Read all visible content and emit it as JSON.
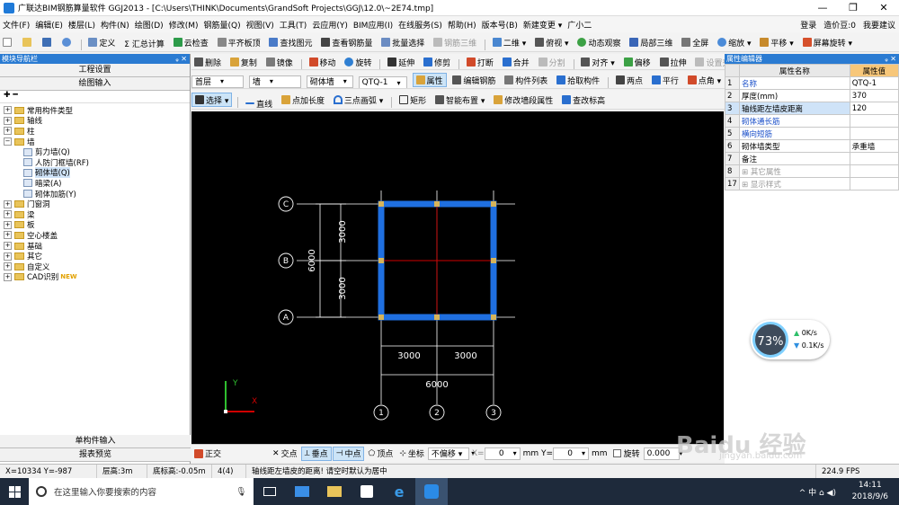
{
  "window": {
    "title": "广联达BIM钢筋算量软件 GGJ2013 - [C:\\Users\\THINK\\Documents\\GrandSoft Projects\\GGJ\\12.0\\~2E74.tmp]",
    "controls": [
      "—",
      "❐",
      "✕"
    ]
  },
  "menubar": {
    "items": [
      "文件(F)",
      "编辑(E)",
      "楼层(L)",
      "构件(N)",
      "绘图(D)",
      "修改(M)",
      "钢筋量(Q)",
      "视图(V)",
      "工具(T)",
      "云应用(Y)",
      "BIM应用(I)",
      "在线服务(S)",
      "帮助(H)",
      "版本号(B)",
      "新建变更 ▾",
      "广小二"
    ],
    "login": "登录",
    "coins": "造价豆:0",
    "suggest": "我要建议"
  },
  "toolbar1": {
    "items": [
      "定义",
      "Σ 汇总计算",
      "云检查",
      "平齐板顶",
      "查找图元",
      "查看钢筋量",
      "批量选择",
      "钢筋三维",
      "二维 ▾",
      "俯视 ▾",
      "动态观察",
      "局部三维",
      "全屏",
      "缩放 ▾",
      "平移 ▾",
      "屏幕旋转 ▾"
    ],
    "disabled_index": 7
  },
  "toolbar2": {
    "items": [
      "删除",
      "复制",
      "镜像",
      "移动",
      "旋转",
      "延伸",
      "修剪",
      "打断",
      "合并",
      "分割",
      "对齐 ▾",
      "偏移",
      "拉伸",
      "设置夹点"
    ],
    "disabled": [
      "分割",
      "设置夹点"
    ]
  },
  "toolbar3": {
    "floor": "首层",
    "category": "墙",
    "subcategory": "砌体墙",
    "component": "QTQ-1",
    "items": [
      "属性",
      "编辑钢筋",
      "构件列表",
      "拾取构件",
      "两点",
      "平行",
      "点角 ▾"
    ]
  },
  "toolbar4": {
    "items": [
      "选择 ▾",
      "直线",
      "点加长度",
      "三点画弧 ▾",
      "矩形",
      "智能布置 ▾",
      "修改墙段属性",
      "查改标高"
    ]
  },
  "leftpanel": {
    "title": "模块导航栏",
    "pins": "ᵩ ✕",
    "buttons": [
      "工程设置",
      "绘图输入"
    ],
    "tree_tool": "✚ ━",
    "tree": [
      {
        "label": "常用构件类型",
        "level": 0,
        "exp": "+"
      },
      {
        "label": "轴线",
        "level": 0,
        "exp": "+"
      },
      {
        "label": "柱",
        "level": 0,
        "exp": "+"
      },
      {
        "label": "墙",
        "level": 0,
        "exp": "−"
      },
      {
        "label": "剪力墙(Q)",
        "level": 1
      },
      {
        "label": "人防门框墙(RF)",
        "level": 1
      },
      {
        "label": "砌体墙(Q)",
        "level": 1,
        "selected": true
      },
      {
        "label": "暗梁(A)",
        "level": 1
      },
      {
        "label": "砌体加筋(Y)",
        "level": 1
      },
      {
        "label": "门窗洞",
        "level": 0,
        "exp": "+"
      },
      {
        "label": "梁",
        "level": 0,
        "exp": "+"
      },
      {
        "label": "板",
        "level": 0,
        "exp": "+"
      },
      {
        "label": "空心楼盖",
        "level": 0,
        "exp": "+"
      },
      {
        "label": "基础",
        "level": 0,
        "exp": "+"
      },
      {
        "label": "其它",
        "level": 0,
        "exp": "+"
      },
      {
        "label": "自定义",
        "level": 0,
        "exp": "+"
      },
      {
        "label": "CAD识别",
        "level": 0,
        "exp": "+",
        "badge": "NEW"
      }
    ],
    "bottom_buttons": [
      "单构件输入",
      "报表预览"
    ]
  },
  "drawing": {
    "axis_rows": [
      "C",
      "B",
      "A"
    ],
    "axis_cols": [
      "1",
      "2",
      "3"
    ],
    "dims_vertical": [
      "3000",
      "3000",
      "6000"
    ],
    "dims_horizontal": [
      "3000",
      "3000",
      "6000"
    ],
    "ucs": {
      "x": "X",
      "y": "Y"
    }
  },
  "rightpanel": {
    "title": "属性编辑器",
    "pins": "ᵩ ✕",
    "headers": [
      "属性名称",
      "属性值"
    ],
    "rows": [
      {
        "n": "1",
        "name": "名称",
        "value": "QTQ-1",
        "style": "blue"
      },
      {
        "n": "2",
        "name": "厚度(mm)",
        "value": "370",
        "style": ""
      },
      {
        "n": "3",
        "name": "轴线距左墙皮距离",
        "value": "120",
        "style": "hl"
      },
      {
        "n": "4",
        "name": "砌体通长筋",
        "value": "",
        "style": "blue"
      },
      {
        "n": "5",
        "name": "横向短筋",
        "value": "",
        "style": "blue"
      },
      {
        "n": "6",
        "name": "砌体墙类型",
        "value": "承重墙",
        "style": ""
      },
      {
        "n": "7",
        "name": "备注",
        "value": "",
        "style": ""
      },
      {
        "n": "8",
        "name": "⊞ 其它属性",
        "value": "",
        "style": "grey"
      },
      {
        "n": "17",
        "name": "⊞ 显示样式",
        "value": "",
        "style": "grey"
      }
    ]
  },
  "meter": {
    "percent": "73%",
    "up": "0K/s",
    "down": "0.1K/s"
  },
  "snapbar": {
    "ortho": "正交",
    "items": [
      "交点",
      "垂点",
      "中点",
      "顶点",
      "坐标",
      "不偏移 ▾"
    ],
    "x_label": "X=",
    "x_value": "0",
    "y_label": "mm Y=",
    "y_value": "0",
    "unit": "mm",
    "rotate": "旋转",
    "rotate_value": "0.000"
  },
  "statusbar": {
    "coords": "X=10334 Y=-987",
    "floor_height": "层高:3m",
    "bottom_elev": "底标高:-0.05m",
    "count": "4(4)",
    "hint": "轴线距左墙皮的距离! 请空时默认为居中",
    "fps": "224.9 FPS"
  },
  "taskbar": {
    "search_placeholder": "在这里输入你要搜索的内容",
    "time": "14:11",
    "date": "2018/9/6",
    "tray": "^ 中 ⌂ ◀)"
  },
  "watermark": {
    "main": "Baidu 经验",
    "sub": "jingyan.baidu.com"
  },
  "colors": {
    "wall": "#1f6fe0",
    "axis": "#d00000",
    "grid": "#ffffff",
    "column": "#d6b45a",
    "panel_head": "#2a7bd2"
  }
}
